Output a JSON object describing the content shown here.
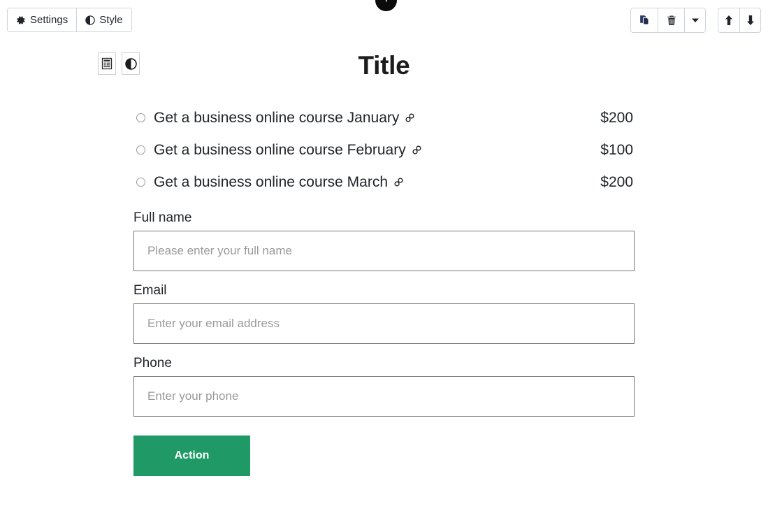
{
  "toolbar": {
    "settings_label": "Settings",
    "style_label": "Style",
    "settings_icon": "gear-icon",
    "style_icon": "contrast-circle-icon",
    "duplicate_icon": "duplicate-icon",
    "delete_icon": "trash-icon",
    "dropdown_icon": "caret-down-icon",
    "move_up_icon": "arrow-up-icon",
    "move_down_icon": "arrow-down-icon",
    "badge_icon": "info-badge-icon"
  },
  "block_tools": {
    "form_icon": "form-block-icon",
    "contrast_icon": "contrast-circle-icon"
  },
  "page": {
    "title": "Title"
  },
  "options": [
    {
      "label": "Get a business online course January",
      "price": "$200",
      "link_icon": "link-icon"
    },
    {
      "label": "Get a business online course February",
      "price": "$100",
      "link_icon": "link-icon"
    },
    {
      "label": "Get a business online course March",
      "price": "$200",
      "link_icon": "link-icon"
    }
  ],
  "fields": [
    {
      "label": "Full name",
      "value": "",
      "placeholder": "Please enter your full name"
    },
    {
      "label": "Email",
      "value": "",
      "placeholder": "Enter your email address"
    },
    {
      "label": "Phone",
      "value": "",
      "placeholder": "Enter your phone"
    }
  ],
  "action": {
    "label": "Action",
    "color": "#1f9a66"
  }
}
